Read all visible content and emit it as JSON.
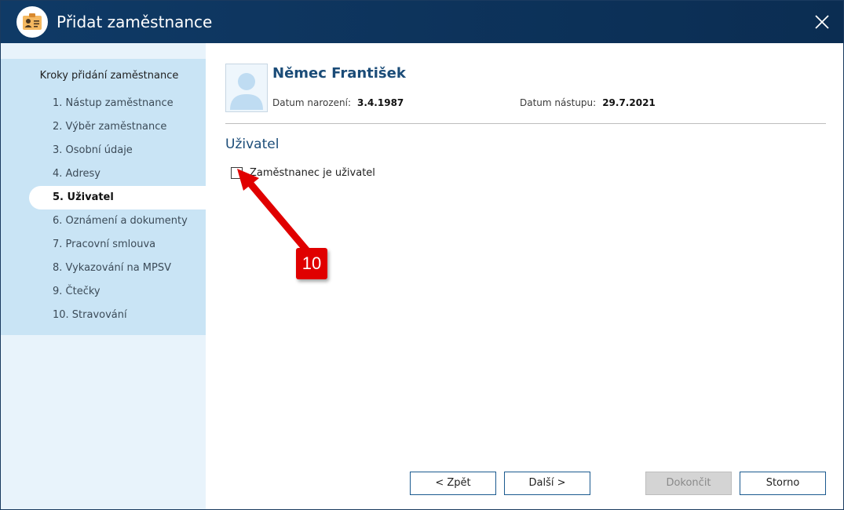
{
  "window": {
    "title": "Přidat zaměstnance",
    "title_bar_color": "#0f3a66"
  },
  "icons": {
    "app": "employee-card-icon",
    "close": "close-icon",
    "avatar": "person-silhouette-icon"
  },
  "sidebar": {
    "title": "Kroky přidání zaměstnance",
    "steps": [
      "1. Nástup zaměstnance",
      "2. Výběr zaměstnance",
      "3. Osobní údaje",
      "4. Adresy",
      "5. Uživatel",
      "6. Oznámení a dokumenty",
      "7. Pracovní smlouva",
      "8. Vykazování na MPSV",
      "9. Čtečky",
      "10. Stravování"
    ],
    "active_step_index": 4
  },
  "employee": {
    "name": "Němec František",
    "birth_date_label": "Datum narození:",
    "birth_date": "3.4.1987",
    "start_date_label": "Datum nástupu:",
    "start_date": "29.7.2021"
  },
  "section": {
    "title": "Uživatel",
    "checkbox_label": "Zaměstnanec je uživatel",
    "checkbox_checked": false
  },
  "annotation": {
    "badge_number": "10",
    "color": "#e00000"
  },
  "buttons": {
    "back": "< Zpět",
    "next": "Další >",
    "finish": "Dokončit",
    "cancel": "Storno"
  }
}
